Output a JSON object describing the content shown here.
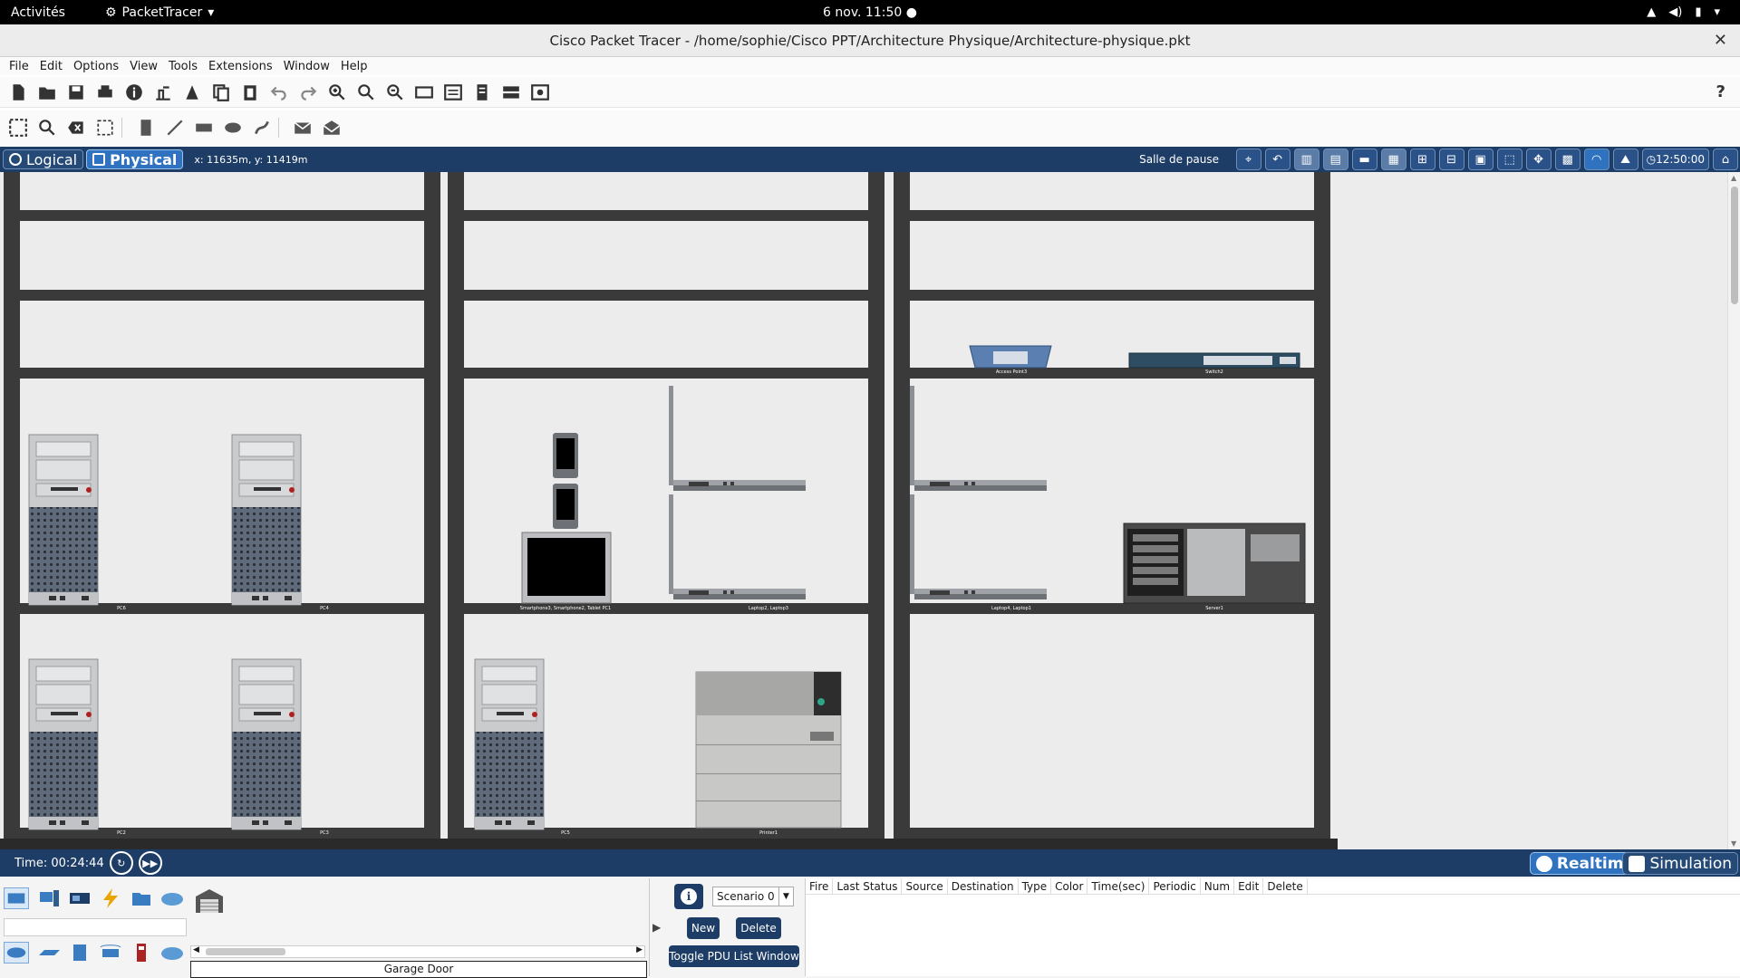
{
  "topbar": {
    "activities": "Activités",
    "app": "PacketTracer",
    "clock": "6 nov.  11:50"
  },
  "window": {
    "title": "Cisco Packet Tracer - /home/sophie/Cisco PPT/Architecture Physique/Architecture-physique.pkt"
  },
  "menu": [
    "File",
    "Edit",
    "Options",
    "View",
    "Tools",
    "Extensions",
    "Window",
    "Help"
  ],
  "modebar": {
    "logical": "Logical",
    "physical": "Physical",
    "coords": "x: 11635m, y: 11419m",
    "location": "Salle de pause",
    "clock": "12:50:00"
  },
  "labels": {
    "rack1_row4_a": "PC6",
    "rack1_row4_b": "PC4",
    "rack1_row5_a": "PC2",
    "rack1_row5_b": "PC3",
    "rack2_row4_a": "Smartphone3, Smartphone2, Tablet PC1",
    "rack2_row4_b": "Laptop2, Laptop3",
    "rack2_row5_a": "PC5",
    "rack2_row5_b": "Printer1",
    "rack3_row3_a": "Access Point3",
    "rack3_row3_b": "Switch2",
    "rack3_row4_a": "Laptop4, Laptop1",
    "rack3_row4_b": "Server1"
  },
  "timebar": {
    "time": "Time: 00:24:44",
    "realtime": "Realtime",
    "simulation": "Simulation"
  },
  "bottom": {
    "device_name": "Garage Door",
    "scenario": "Scenario 0",
    "new": "New",
    "delete": "Delete",
    "toggle": "Toggle PDU List Window",
    "columns": [
      "Fire",
      "Last Status",
      "Source",
      "Destination",
      "Type",
      "Color",
      "Time(sec)",
      "Periodic",
      "Num",
      "Edit",
      "Delete"
    ]
  },
  "colors": {
    "accent": "#1d3d66",
    "active": "#2f73c0",
    "rack": "#3a3a3a",
    "canvas": "#ececec"
  }
}
